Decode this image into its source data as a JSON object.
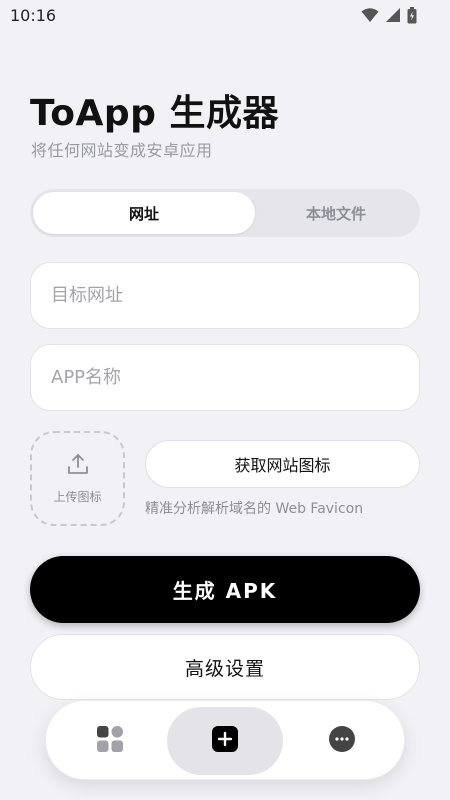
{
  "status_bar": {
    "time": "10:16",
    "icons": [
      "wifi-icon",
      "signal-icon",
      "battery-icon"
    ]
  },
  "header": {
    "title": "ToApp 生成器",
    "subtitle": "将任何网站变成安卓应用"
  },
  "source_tabs": [
    {
      "label": "网址",
      "selected": true
    },
    {
      "label": "本地文件",
      "selected": false
    }
  ],
  "form": {
    "url_placeholder": "目标网址",
    "url_value": "",
    "name_placeholder": "APP名称",
    "name_value": "",
    "upload_icon_label": "上传图标",
    "fetch_favicon_label": "获取网站图标",
    "favicon_hint": "精准分析解析域名的 Web Favicon"
  },
  "actions": {
    "generate_label": "生成 APK",
    "advanced_label": "高级设置"
  },
  "bottom_nav": [
    {
      "icon": "grid-apps-icon",
      "active": false
    },
    {
      "icon": "add-square-icon",
      "active": true
    },
    {
      "icon": "more-circle-icon",
      "active": false
    }
  ],
  "colors": {
    "background": "#f2f1f6",
    "primary": "#000000",
    "surface": "#ffffff",
    "muted_text": "#8e8e96"
  }
}
